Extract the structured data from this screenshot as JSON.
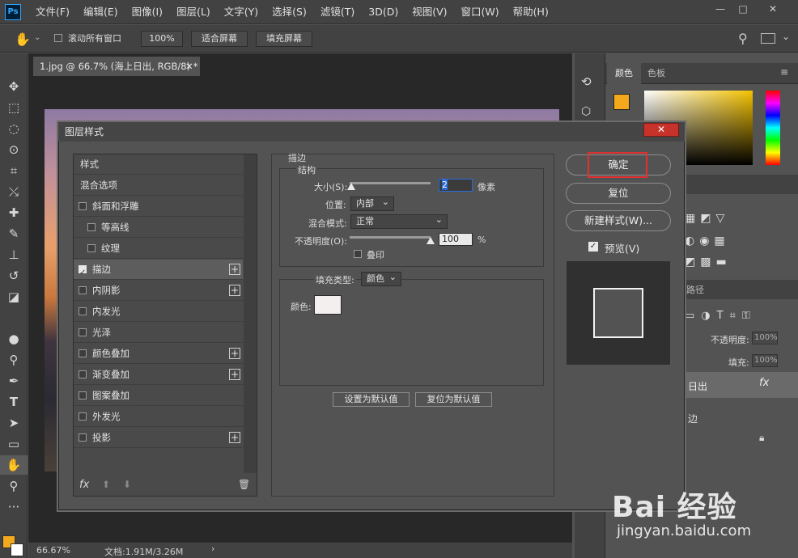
{
  "app": {
    "logo": "Ps"
  },
  "menu": [
    "文件(F)",
    "编辑(E)",
    "图像(I)",
    "图层(L)",
    "文字(Y)",
    "选择(S)",
    "滤镜(T)",
    "3D(D)",
    "视图(V)",
    "窗口(W)",
    "帮助(H)"
  ],
  "window": {
    "minimize": "—",
    "restore": "□",
    "close": "✕"
  },
  "options": {
    "scroll_all": "滚动所有窗口",
    "zoom": "100%",
    "fit_screen": "适合屏幕",
    "fill_screen": "填充屏幕"
  },
  "document": {
    "tab": "1.jpg @ 66.7% (海上日出, RGB/8) *",
    "zoom": "66.67%",
    "doc_info": "文档:1.91M/3.26M"
  },
  "panels": {
    "color_tab": "颜色",
    "swatches_tab": "色板",
    "opacity_label": "不透明度:",
    "opacity_value": "100%",
    "fill_label": "填充:",
    "fill_value": "100%",
    "layer_name": "日出",
    "effect_name": "边",
    "paths_tab": "路径"
  },
  "dialog": {
    "title": "图层样式",
    "close": "✕",
    "styles": [
      {
        "label": "样式",
        "checkbox": false,
        "plus": false
      },
      {
        "label": "混合选项",
        "checkbox": false,
        "plus": false
      },
      {
        "label": "斜面和浮雕",
        "checkbox": true,
        "checked": false,
        "plus": false
      },
      {
        "label": "等高线",
        "checkbox": true,
        "checked": false,
        "plus": false,
        "indent": true
      },
      {
        "label": "纹理",
        "checkbox": true,
        "checked": false,
        "plus": false,
        "indent": true
      },
      {
        "label": "描边",
        "checkbox": true,
        "checked": true,
        "plus": true,
        "selected": true
      },
      {
        "label": "内阴影",
        "checkbox": true,
        "checked": false,
        "plus": true
      },
      {
        "label": "内发光",
        "checkbox": true,
        "checked": false,
        "plus": false
      },
      {
        "label": "光泽",
        "checkbox": true,
        "checked": false,
        "plus": false
      },
      {
        "label": "颜色叠加",
        "checkbox": true,
        "checked": false,
        "plus": true
      },
      {
        "label": "渐变叠加",
        "checkbox": true,
        "checked": false,
        "plus": true
      },
      {
        "label": "图案叠加",
        "checkbox": true,
        "checked": false,
        "plus": false
      },
      {
        "label": "外发光",
        "checkbox": true,
        "checked": false,
        "plus": false
      },
      {
        "label": "投影",
        "checkbox": true,
        "checked": false,
        "plus": true
      }
    ],
    "fx_label": "fx",
    "stroke": {
      "section": "描边",
      "structure": "结构",
      "size_label": "大小(S):",
      "size_value": "2",
      "size_unit": "像素",
      "size_fraction": 0.02,
      "position_label": "位置:",
      "position_value": "内部",
      "blend_label": "混合模式:",
      "blend_value": "正常",
      "opacity_label": "不透明度(O):",
      "opacity_value": "100",
      "opacity_unit": "%",
      "opacity_fraction": 1.0,
      "overprint_label": "叠印",
      "fill_type_label": "填充类型:",
      "fill_type_value": "颜色",
      "color_label": "颜色:",
      "color_swatch": "#f3efef",
      "set_default": "设置为默认值",
      "reset_default": "复位为默认值"
    },
    "buttons": {
      "ok": "确定",
      "reset": "复位",
      "new_style": "新建样式(W)...",
      "preview_label": "预览(V)",
      "preview_checked": true
    }
  },
  "watermark": {
    "brand": "Bai 经验",
    "url": "jingyan.baidu.com"
  },
  "colors": {
    "foreground": "#f4a91c",
    "background": "#ffffff",
    "highlight": "#e03030"
  }
}
